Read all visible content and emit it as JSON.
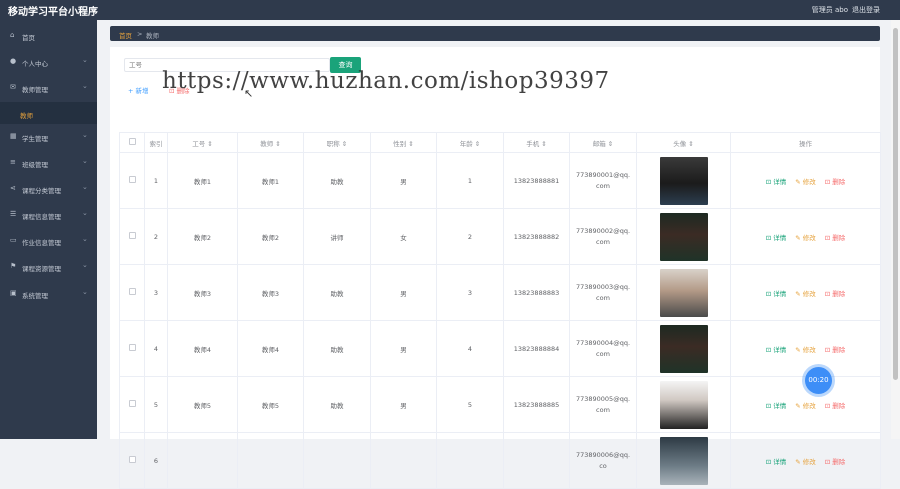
{
  "header": {
    "title": "移动学习平台小程序",
    "user": "管理员 abo",
    "logout": "退出登录"
  },
  "sidebar": {
    "items": [
      {
        "icon": "home-icon",
        "glyph": "⌂",
        "label": "首页",
        "has_arrow": false
      },
      {
        "icon": "user-icon",
        "glyph": "●",
        "label": "个人中心",
        "has_arrow": true
      },
      {
        "icon": "mail-icon",
        "glyph": "✉",
        "label": "教师管理",
        "has_arrow": true
      },
      {
        "icon": "grid-icon",
        "glyph": "▦",
        "label": "学生管理",
        "has_arrow": true
      },
      {
        "icon": "list-icon",
        "glyph": "≡",
        "label": "班级管理",
        "has_arrow": true
      },
      {
        "icon": "share-icon",
        "glyph": "⋖",
        "label": "课程分类管理",
        "has_arrow": true
      },
      {
        "icon": "sliders-icon",
        "glyph": "☰",
        "label": "课程信息管理",
        "has_arrow": true
      },
      {
        "icon": "monitor-icon",
        "glyph": "▭",
        "label": "作业信息管理",
        "has_arrow": true
      },
      {
        "icon": "flag-icon",
        "glyph": "⚑",
        "label": "课程资源管理",
        "has_arrow": true
      },
      {
        "icon": "settings-icon",
        "glyph": "▣",
        "label": "系统管理",
        "has_arrow": true
      }
    ],
    "sub_item": "教师"
  },
  "breadcrumb": {
    "home": "首页",
    "sep": ">",
    "current": "教师"
  },
  "search": {
    "placeholder": "工号",
    "button": "查询"
  },
  "watermark": "https://www.huzhan.com/ishop39397",
  "toolbar": {
    "add": "+ 新增",
    "delete": "⊡ 删除"
  },
  "table": {
    "headers": [
      "索引",
      "工号 ⇕",
      "教师 ⇕",
      "职称 ⇕",
      "性别 ⇕",
      "年龄 ⇕",
      "手机 ⇕",
      "邮箱 ⇕",
      "头像 ⇕",
      "操作"
    ],
    "rows": [
      {
        "index": "1",
        "id": "教师1",
        "name": "教师1",
        "title": "助教",
        "gender": "男",
        "age": "1",
        "phone": "13823888881",
        "email": "773890001@qq.com",
        "avatar": "av1"
      },
      {
        "index": "2",
        "id": "教师2",
        "name": "教师2",
        "title": "讲师",
        "gender": "女",
        "age": "2",
        "phone": "13823888882",
        "email": "773890002@qq.com",
        "avatar": "av2"
      },
      {
        "index": "3",
        "id": "教师3",
        "name": "教师3",
        "title": "助教",
        "gender": "男",
        "age": "3",
        "phone": "13823888883",
        "email": "773890003@qq.com",
        "avatar": "av3"
      },
      {
        "index": "4",
        "id": "教师4",
        "name": "教师4",
        "title": "助教",
        "gender": "男",
        "age": "4",
        "phone": "13823888884",
        "email": "773890004@qq.com",
        "avatar": "av2"
      },
      {
        "index": "5",
        "id": "教师5",
        "name": "教师5",
        "title": "助教",
        "gender": "男",
        "age": "5",
        "phone": "13823888885",
        "email": "773890005@qq.com",
        "avatar": "av5"
      },
      {
        "index": "6",
        "id": "",
        "name": "",
        "title": "",
        "gender": "",
        "age": "",
        "phone": "",
        "email": "773890006@qq.co",
        "avatar": "av6"
      }
    ],
    "ops": {
      "detail": "⊡ 详情",
      "edit": "✎ 修改",
      "delete": "⊡ 删除"
    }
  },
  "timer": "00:20"
}
